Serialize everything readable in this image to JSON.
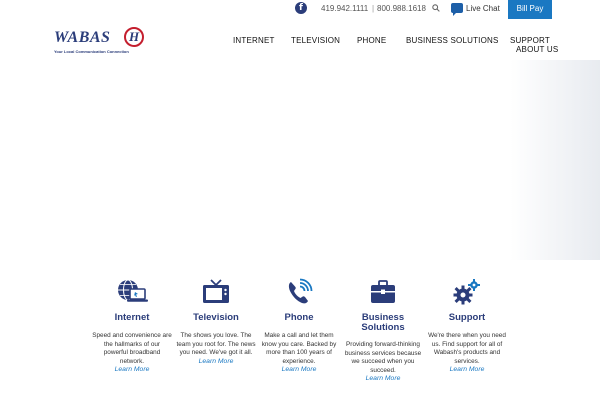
{
  "topbar": {
    "phone_primary": "419.942.1111",
    "phone_separator": "|",
    "phone_secondary": "800.988.1618",
    "live_chat_label": "Live Chat",
    "bill_pay_label": "Bill Pay",
    "facebook_glyph": "f"
  },
  "logo": {
    "word": "WABAS",
    "letter": "H",
    "tagline": "Your Local Communication Connection"
  },
  "nav": {
    "items": [
      {
        "label": "INTERNET"
      },
      {
        "label": "TELEVISION"
      },
      {
        "label": "PHONE"
      },
      {
        "label": "BUSINESS SOLUTIONS"
      },
      {
        "label": "SUPPORT"
      },
      {
        "label": "ABOUT US"
      }
    ]
  },
  "services": [
    {
      "title": "Internet",
      "desc": "Speed and convenience are the hallmarks of our powerful broadband network.",
      "link": "Learn More",
      "icon": "globe-laptop-icon"
    },
    {
      "title": "Television",
      "desc": "The shows you love. The team you root for. The news you need. We've got it all.",
      "link": "Learn More",
      "icon": "tv-icon"
    },
    {
      "title": "Phone",
      "desc": "Make a call and let them know you care. Backed by more than 100 years of experience.",
      "link": "Learn More",
      "icon": "phone-icon"
    },
    {
      "title": "Business Solutions",
      "desc": "Providing forward-thinking business services because we succeed when you succeed.",
      "link": "Learn More",
      "icon": "briefcase-icon"
    },
    {
      "title": "Support",
      "desc": "We're there when you need us. Find support for all of Wabash's products and services.",
      "link": "Learn More",
      "icon": "gears-icon"
    }
  ],
  "colors": {
    "brand_navy": "#2b3d7a",
    "brand_blue": "#1a78c2",
    "brand_red": "#c41e2e"
  }
}
